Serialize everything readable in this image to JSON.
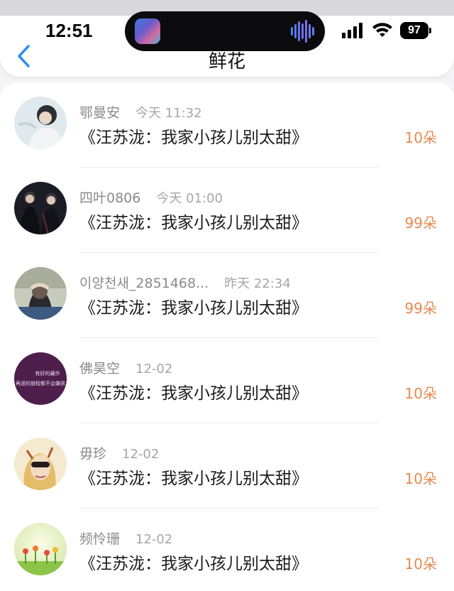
{
  "status": {
    "time": "12:51",
    "battery": "97"
  },
  "nav": {
    "title": "鲜花",
    "back_icon": "chevron-left-icon"
  },
  "colors": {
    "accent": "#2f8ef5",
    "count": "#e88a4c"
  },
  "items": [
    {
      "name": "鄂曼安",
      "time": "今天 11:32",
      "title": "《汪苏泷：我家小孩儿别太甜》",
      "count": "10朵"
    },
    {
      "name": "四叶0806",
      "time": "今天 01:00",
      "title": "《汪苏泷：我家小孩儿别太甜》",
      "count": "99朵"
    },
    {
      "name": "이양천새_2851468...",
      "time": "昨天 22:34",
      "title": "《汪苏泷：我家小孩儿别太甜》",
      "count": "99朵"
    },
    {
      "name": "佛昊空",
      "time": "12-02",
      "title": "《汪苏泷：我家小孩儿别太甜》",
      "count": "10朵",
      "avatar_text": [
        "有好的藏作",
        "再遥的旅程都不会嫌孩"
      ]
    },
    {
      "name": "毋珍",
      "time": "12-02",
      "title": "《汪苏泷：我家小孩儿别太甜》",
      "count": "10朵"
    },
    {
      "name": "频怜珊",
      "time": "12-02",
      "title": "《汪苏泷：我家小孩儿别太甜》",
      "count": "10朵"
    }
  ]
}
